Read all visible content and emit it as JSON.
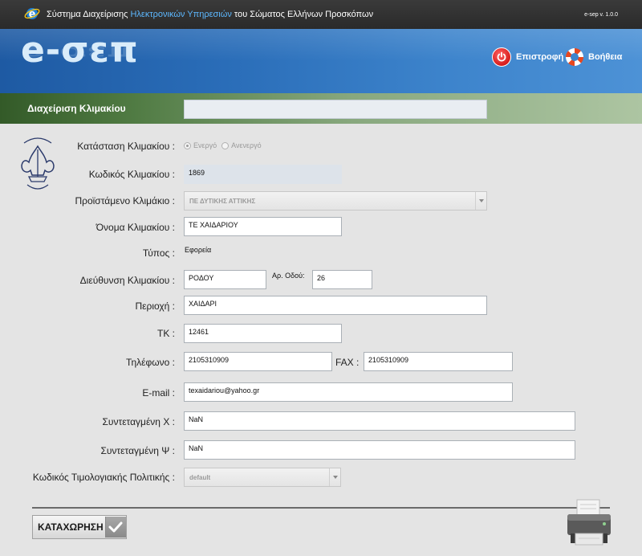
{
  "topbar": {
    "title_pre": "Σύστημα Διαχείρισης",
    "title_hl": "Ηλεκτρονικών Υπηρεσιών",
    "title_post": "του Σώματος Ελλήνων Προσκόπων",
    "version": "e-sep v. 1.0.0"
  },
  "banner": {
    "logo": "e-σεπ",
    "back_label": "Επιστροφή",
    "help_label": "Βοήθεια"
  },
  "section": {
    "title": "Διαχείριση Κλιμακίου",
    "box_value": ""
  },
  "form": {
    "status": {
      "label": "Κατάσταση Κλιμακίου :",
      "opt_active": "Ενεργό",
      "opt_inactive": "Ανενεργό",
      "selected": "Ενεργό"
    },
    "code": {
      "label": "Κωδικός Κλιμακίου :",
      "value": "1869"
    },
    "parent": {
      "label": "Προϊστάμενο Κλιμάκιο :",
      "value": "ΠΕ ΔΥΤΙΚΗΣ ΑΤΤΙΚΗΣ"
    },
    "name": {
      "label": "Όνομα Κλιμακίου :",
      "value": "ΤΕ ΧΑΙΔΑΡΙΟΥ"
    },
    "type": {
      "label": "Τύπος :",
      "value": "Εφορεία"
    },
    "address": {
      "label": "Διεύθυνση Κλιμακίου :",
      "value": "ΡΟΔΟΥ",
      "number_label": "Αρ. Οδού:",
      "number_value": "26"
    },
    "area": {
      "label": "Περιοχή :",
      "value": "ΧΑΙΔΑΡΙ"
    },
    "postcode": {
      "label": "ΤΚ :",
      "value": "12461"
    },
    "phone": {
      "label": "Τηλέφωνο :",
      "value": "2105310909",
      "fax_label": "FAX :",
      "fax_value": "2105310909"
    },
    "email": {
      "label": "E-mail :",
      "value": "texaidariou@yahoo.gr"
    },
    "coord_x": {
      "label": "Συντεταγμένη Χ :",
      "value": "NaN"
    },
    "coord_y": {
      "label": "Συντεταγμένη Ψ :",
      "value": "NaN"
    },
    "pricing": {
      "label": "Κωδικός Τιμολογιακής Πολιτικής :",
      "value": "default"
    }
  },
  "footer": {
    "submit_label": "ΚΑΤΑΧΩΡΗΣΗ"
  },
  "icons": {
    "browser": "e-logo-icon",
    "back": "power-icon",
    "help": "lifebuoy-icon",
    "submit": "checkmark-icon",
    "print": "printer-icon",
    "emblem": "scout-emblem"
  },
  "colors": {
    "banner": "#2a6db8",
    "section_bar": "#4f7a42",
    "highlight_text": "#5db8ff"
  }
}
